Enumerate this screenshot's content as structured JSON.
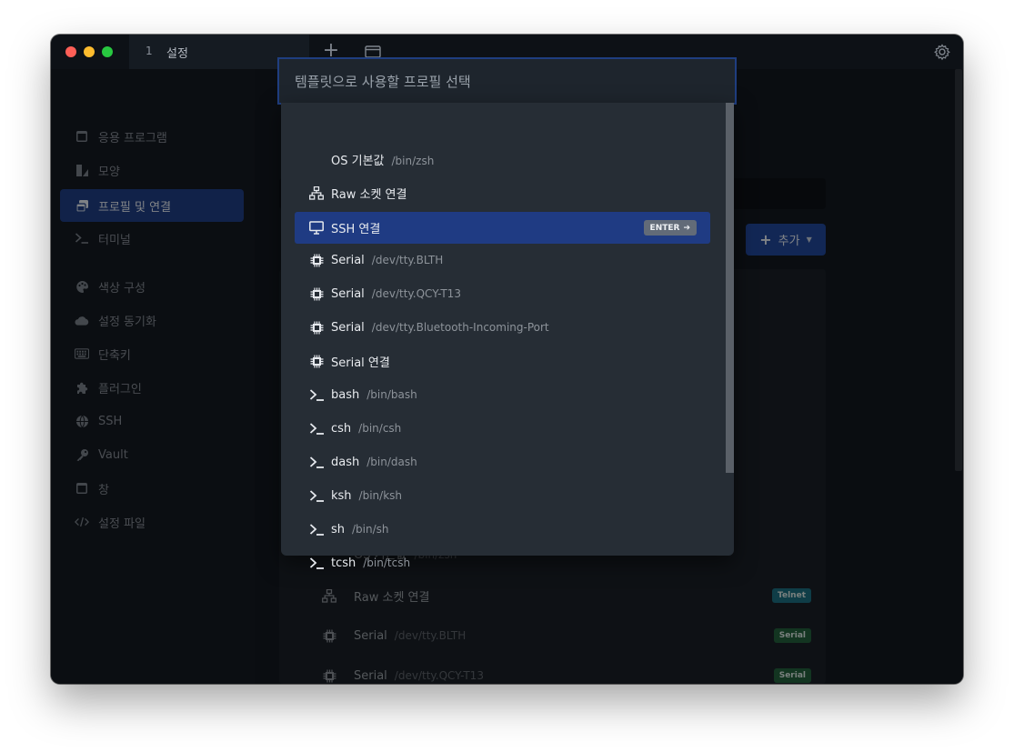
{
  "titlebar": {
    "tab_number": "1",
    "tab_title": "설정",
    "new_tab_icon": "plus-icon",
    "window_icon": "window-icon",
    "settings_icon": "gear-icon"
  },
  "sidebar": {
    "items": [
      {
        "label": "응용 프로그램",
        "icon": "window-icon",
        "active": false
      },
      {
        "label": "모양",
        "icon": "shapes-icon",
        "active": false
      },
      {
        "label": "프로필 및 연결",
        "icon": "windows-stack-icon",
        "active": true
      },
      {
        "label": "터미널",
        "icon": "terminal-icon",
        "active": false
      },
      {
        "label": "색상 구성",
        "icon": "palette-icon",
        "active": false
      },
      {
        "label": "설정 동기화",
        "icon": "cloud-icon",
        "active": false
      },
      {
        "label": "단축키",
        "icon": "keyboard-icon",
        "active": false
      },
      {
        "label": "플러그인",
        "icon": "puzzle-icon",
        "active": false
      },
      {
        "label": "SSH",
        "icon": "globe-icon",
        "active": false
      },
      {
        "label": "Vault",
        "icon": "key-icon",
        "active": false
      },
      {
        "label": "창",
        "icon": "window-icon",
        "active": false
      },
      {
        "label": "설정 파일",
        "icon": "code-icon",
        "active": false
      }
    ]
  },
  "main": {
    "add_button_label": "추가",
    "background_rows": [
      {
        "name": "OS 기본값",
        "path": "/bin/zsh",
        "icon": "",
        "badge": ""
      },
      {
        "name": "Raw 소켓 연결",
        "path": "",
        "icon": "network-icon",
        "badge": "Telnet"
      },
      {
        "name": "Serial",
        "path": "/dev/tty.BLTH",
        "icon": "chip-icon",
        "badge": "Serial"
      },
      {
        "name": "Serial",
        "path": "/dev/tty.QCY-T13",
        "icon": "chip-icon",
        "badge": "Serial"
      }
    ]
  },
  "palette": {
    "placeholder": "템플릿으로 사용할 프로필 선택",
    "enter_label": "ENTER",
    "items": [
      {
        "name": "OS 기본값",
        "path": "/bin/zsh",
        "icon": "",
        "selected": false
      },
      {
        "name": "Raw 소켓 연결",
        "path": "",
        "icon": "network-icon",
        "selected": false
      },
      {
        "name": "SSH 연결",
        "path": "",
        "icon": "monitor-icon",
        "selected": true
      },
      {
        "name": "Serial",
        "path": "/dev/tty.BLTH",
        "icon": "chip-icon",
        "selected": false
      },
      {
        "name": "Serial",
        "path": "/dev/tty.QCY-T13",
        "icon": "chip-icon",
        "selected": false
      },
      {
        "name": "Serial",
        "path": "/dev/tty.Bluetooth-Incoming-Port",
        "icon": "chip-icon",
        "selected": false
      },
      {
        "name": "Serial 연결",
        "path": "",
        "icon": "chip-icon",
        "selected": false
      },
      {
        "name": "bash",
        "path": "/bin/bash",
        "icon": "terminal-icon",
        "selected": false
      },
      {
        "name": "csh",
        "path": "/bin/csh",
        "icon": "terminal-icon",
        "selected": false
      },
      {
        "name": "dash",
        "path": "/bin/dash",
        "icon": "terminal-icon",
        "selected": false
      },
      {
        "name": "ksh",
        "path": "/bin/ksh",
        "icon": "terminal-icon",
        "selected": false
      },
      {
        "name": "sh",
        "path": "/bin/sh",
        "icon": "terminal-icon",
        "selected": false
      },
      {
        "name": "tcsh",
        "path": "/bin/tcsh",
        "icon": "terminal-icon",
        "selected": false
      }
    ]
  },
  "colors": {
    "accent": "#1f3b83",
    "telnet_badge": "#1c6f82",
    "serial_badge": "#23613c"
  }
}
